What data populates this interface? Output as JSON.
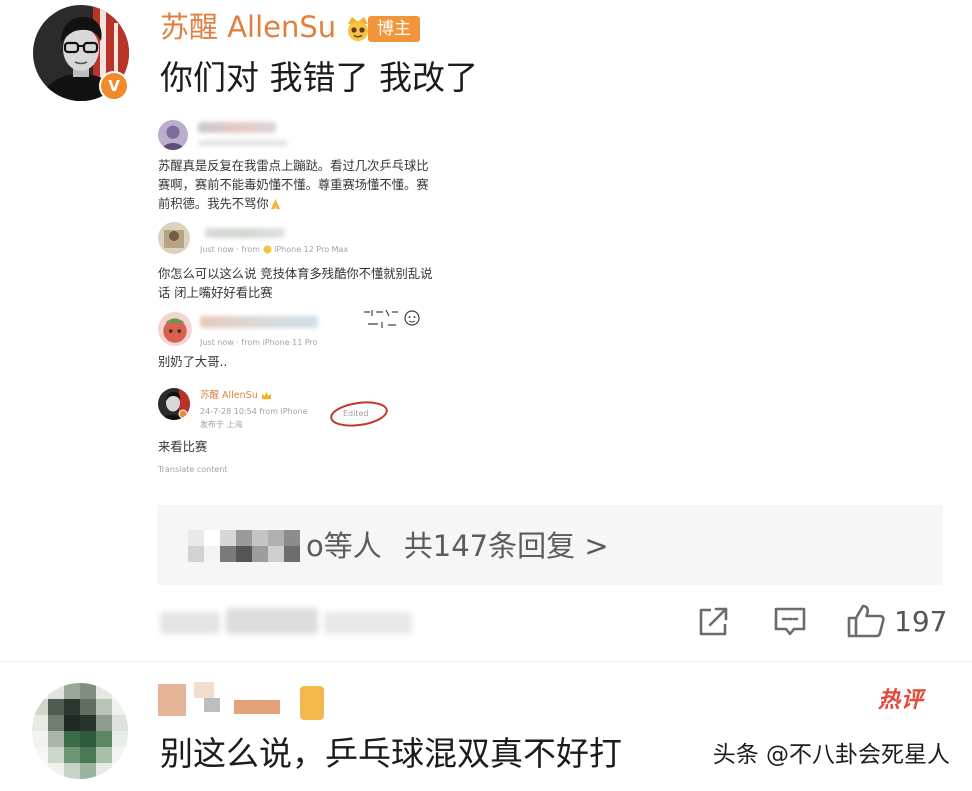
{
  "post": {
    "author": {
      "name": "苏醒 AllenSu",
      "badge_label": "博主",
      "verified_label": "V"
    },
    "text": "你们对 我错了 我改了",
    "image": {
      "comments": [
        {
          "text": "苏醒真是反复在我雷点上蹦跶。看过几次乒乓球比赛啊，赛前不能毒奶懂不懂。尊重赛场懂不懂。赛前积德。我先不骂你"
        },
        {
          "meta_prefix": "Just now · from",
          "meta_device": "iPhone 12 Pro Max",
          "text": "你怎么可以这么说 竞技体育多残酷你不懂就别乱说话 闭上嘴好好看比赛"
        },
        {
          "meta": "Just now · from iPhone 11 Pro",
          "text": "别奶了大哥.."
        },
        {
          "name": "苏醒 AllenSu",
          "meta": "24-7-28 10:54 from iPhone",
          "edited_label": "Edited",
          "location": "发布于 上海",
          "text": "来看比赛"
        }
      ],
      "translate_label": "Translate content"
    },
    "replies": {
      "others_label": "o等人",
      "count_label": "共147条回复 >"
    },
    "actions": {
      "like_count": "197"
    }
  },
  "hot_comment": {
    "tag_label": "热评",
    "text": "别这么说，乒乓球混双真不好打"
  },
  "watermark": "头条 @不八卦会死星人",
  "icons": [
    "verified-icon",
    "blogger-crown-icon",
    "crown-icon",
    "emoji-icon",
    "pray-hands-icon",
    "sticker-icon",
    "share-icon",
    "comment-icon",
    "like-icon"
  ],
  "colors": {
    "author_name": "#e0803f",
    "badge_bg": "#f0953b",
    "verified": "#f08a2c",
    "hot_tag": "#e5473a",
    "edited_circle": "#c0392b",
    "replies_bg": "#f6f6f6"
  }
}
